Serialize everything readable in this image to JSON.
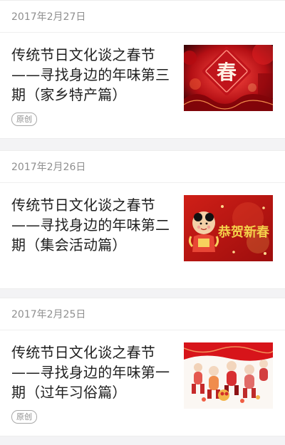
{
  "feed": {
    "items": [
      {
        "date": "2017年2月27日",
        "title": "传统节日文化谈之春节——寻找身边的年味第三期（家乡特产篇）",
        "badge": "原创",
        "thumb_icon": "spring-festival-fu-lantern-image",
        "thumb_text": "春"
      },
      {
        "date": "2017年2月26日",
        "title": "传统节日文化谈之春节——寻找身边的年味第二期（集会活动篇）",
        "thumb_icon": "new-year-greeting-card-image",
        "thumb_text": "恭贺新春"
      },
      {
        "date": "2017年2月25日",
        "title": "传统节日文化谈之春节——寻找身边的年味第一期（过年习俗篇）",
        "badge": "原创",
        "thumb_icon": "festive-children-parade-image"
      }
    ]
  }
}
